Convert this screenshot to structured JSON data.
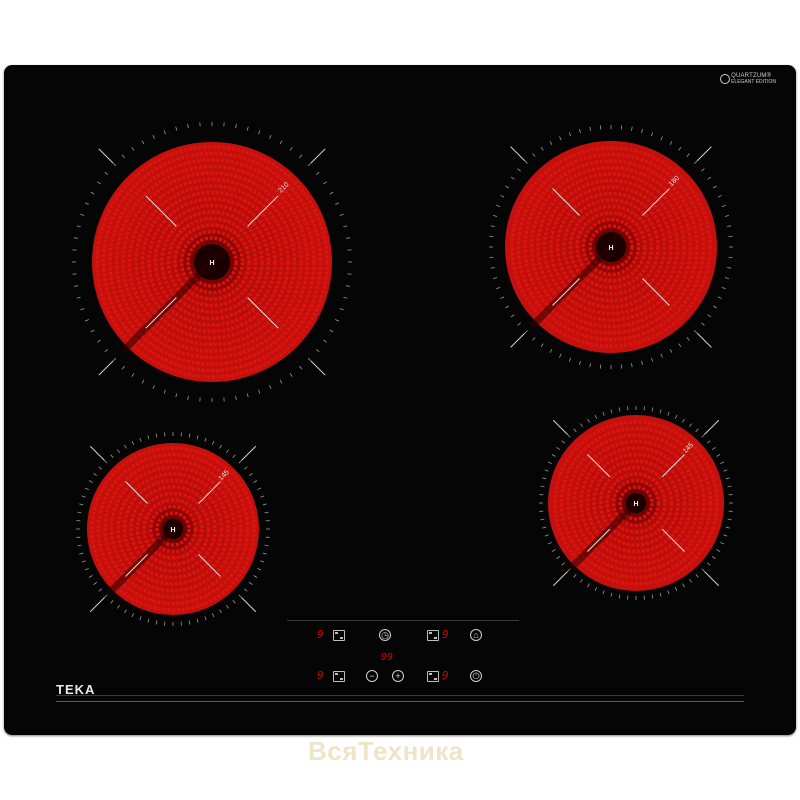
{
  "hob": {
    "brand": "TEKA",
    "badge_title": "QUARTZUM®",
    "badge_sub": "ELEGANT EDITION",
    "watermark": "ВсяТехника"
  },
  "zones": [
    {
      "label": "210",
      "center": "H"
    },
    {
      "label": "180",
      "center": "H"
    },
    {
      "label": "145",
      "center": "H"
    },
    {
      "label": "145",
      "center": "H"
    }
  ],
  "controls": {
    "levels": [
      "9",
      "9",
      "9",
      "9"
    ],
    "timer_display": "99",
    "icons": {
      "timer": "clock-icon",
      "lock": "lock-icon",
      "minus": "minus-icon",
      "plus": "plus-icon",
      "power": "power-icon",
      "select": "zone-select-icon"
    }
  },
  "colors": {
    "glass": "#050505",
    "coil": "#e0140f",
    "display": "#d10000"
  }
}
